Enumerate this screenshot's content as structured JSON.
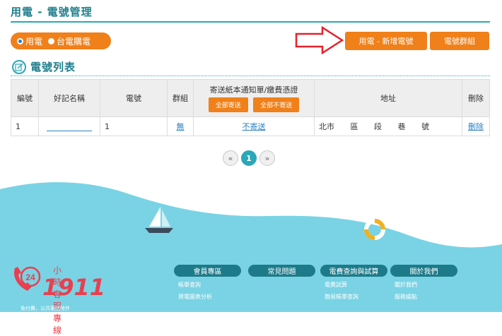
{
  "page": {
    "title": "用電 - 電號管理",
    "radio": {
      "option_1": "用電",
      "option_2": "台電購電",
      "selected": "用電"
    },
    "actions": {
      "add_label": "用電 - 新增電號",
      "group_label": "電號群組"
    },
    "section_title": "電號列表"
  },
  "table": {
    "headers": {
      "no": "編號",
      "nickname": "好記名稱",
      "number": "電號",
      "group": "群組",
      "mail": "寄送紙本通知單/繳費憑證",
      "mail_all_send": "全部寄送",
      "mail_all_nosend": "全部不寄送",
      "address": "地址",
      "delete": "刪除"
    },
    "rows": [
      {
        "no": "1",
        "nickname": "",
        "number": "1",
        "group": "無",
        "mail": "不寄送",
        "address": [
          "北市",
          "區",
          "段",
          "巷",
          "號"
        ],
        "delete": "刪除"
      }
    ]
  },
  "pager": {
    "prev": "«",
    "current": "1",
    "next": "»"
  },
  "footer": {
    "hotline_label": "小時客服專線",
    "hotline_badge": "24",
    "hotline_number": "1911",
    "hotline_note": "免付費，公共電話除外",
    "columns": [
      {
        "title": "會員專區",
        "links": [
          "帳單查詢",
          "用電圖表分析"
        ]
      },
      {
        "title": "常見問題",
        "links": []
      },
      {
        "title": "電費查詢與試算",
        "links": [
          "電費試算",
          "簡易帳單查詢"
        ]
      },
      {
        "title": "關於我們",
        "links": [
          "關於我們",
          "服務據點"
        ]
      }
    ]
  },
  "colors": {
    "accent": "#f08019",
    "teal": "#2aa8b8",
    "wave": "#79d3e4",
    "hotline": "#e8404f"
  }
}
